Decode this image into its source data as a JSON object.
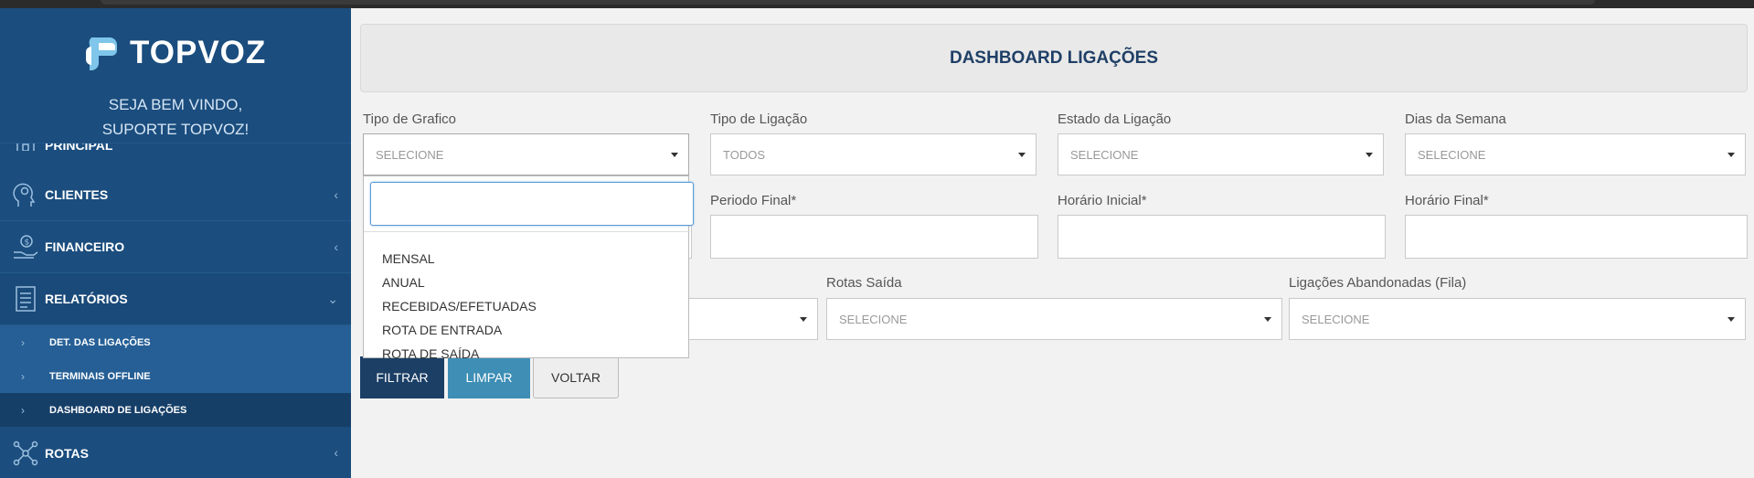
{
  "brand": {
    "logo_text": "TOPVOZ",
    "welcome_line1": "SEJA BEM VINDO,",
    "welcome_line2": "SUPORTE TOPVOZ!"
  },
  "sidebar": {
    "partial_item": "PRINCIPAL",
    "items": [
      {
        "label": "CLIENTES",
        "icon": "head-gears-icon"
      },
      {
        "label": "FINANCEIRO",
        "icon": "hand-money-icon"
      },
      {
        "label": "RELATÓRIOS",
        "icon": "report-icon"
      },
      {
        "label": "ROTAS",
        "icon": "network-icon"
      }
    ],
    "submenu": [
      "DET. DAS LIGAÇÕES",
      "TERMINAIS OFFLINE",
      "DASHBOARD DE LIGAÇÕES"
    ]
  },
  "page": {
    "title": "DASHBOARD LIGAÇÕES"
  },
  "filters": {
    "tipo_grafico": {
      "label": "Tipo de Grafico",
      "value": "SELECIONE"
    },
    "tipo_ligacao": {
      "label": "Tipo de Ligação",
      "value": "TODOS"
    },
    "estado_ligacao": {
      "label": "Estado da Ligação",
      "value": "SELECIONE"
    },
    "dias_semana": {
      "label": "Dias da Semana",
      "value": "SELECIONE"
    },
    "periodo_final": {
      "label": "Periodo Final*",
      "value": ""
    },
    "horario_inicial": {
      "label": "Horário Inicial*",
      "value": ""
    },
    "horario_final": {
      "label": "Horário Final*",
      "value": ""
    },
    "rotas_saida": {
      "label": "Rotas Saída",
      "value": "SELECIONE"
    },
    "ligacoes_abandonadas": {
      "label": "Ligações Abandonadas (Fila)",
      "value": "SELECIONE"
    }
  },
  "dropdown": {
    "search_value": "",
    "options": [
      "MENSAL",
      "ANUAL",
      "RECEBIDAS/EFETUADAS",
      "ROTA DE ENTRADA",
      "ROTA DE SAÍDA"
    ]
  },
  "buttons": {
    "filtrar": "FILTRAR",
    "limpar": "LIMPAR",
    "voltar": "VOLTAR"
  },
  "colors": {
    "sidebar": "#1b4d7e",
    "title": "#1f3f66",
    "filtrar": "#1c3f66",
    "limpar": "#3e8eb5"
  }
}
